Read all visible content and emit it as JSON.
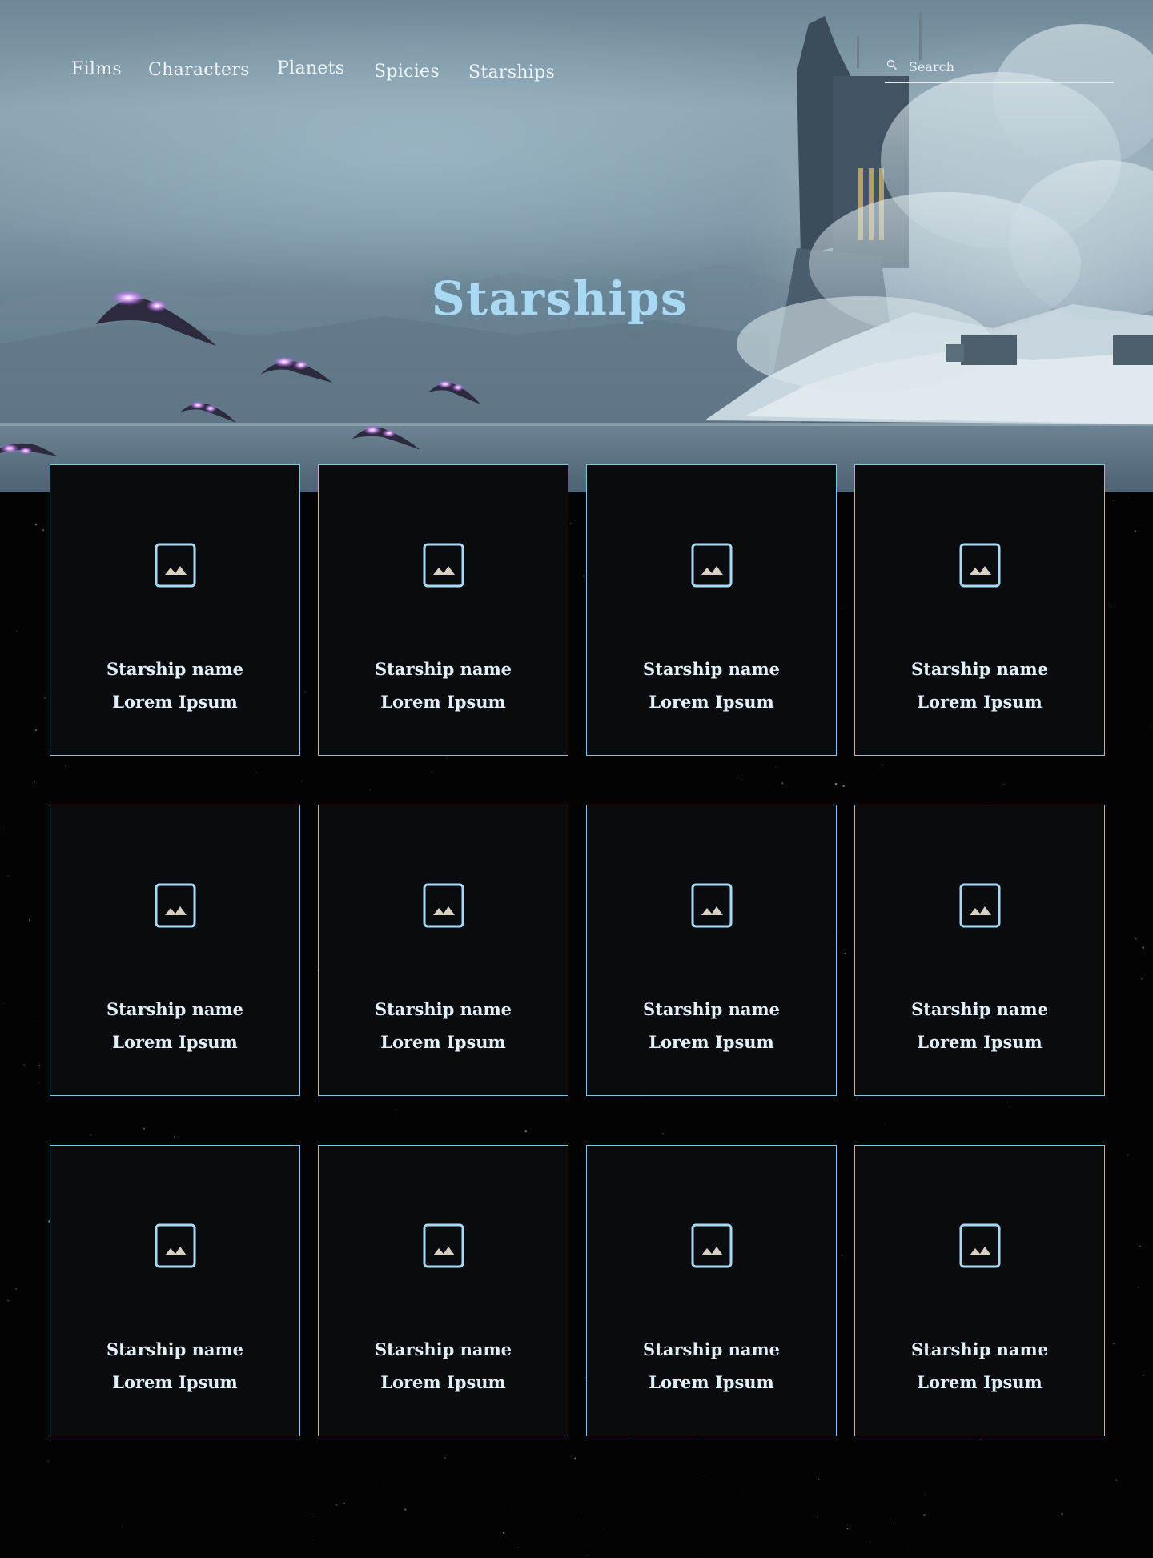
{
  "nav": {
    "items": [
      {
        "label": "Films"
      },
      {
        "label": "Characters"
      },
      {
        "label": "Planets"
      },
      {
        "label": "Spicies"
      },
      {
        "label": "Starships"
      }
    ]
  },
  "search": {
    "placeholder": "Search",
    "value": "",
    "icon": "search-icon"
  },
  "hero": {
    "title": "Starships"
  },
  "colors": {
    "accent": "#a9d9f3",
    "card_border": "#8fbfd9",
    "card_bg": "#0a0b0f",
    "page_bg": "#030304",
    "ship_glow": "#c77dff"
  },
  "cards": [
    {
      "name": "Starship name",
      "subtitle": "Lorem Ipsum",
      "icon": "image-placeholder-icon"
    },
    {
      "name": "Starship name",
      "subtitle": "Lorem Ipsum",
      "icon": "image-placeholder-icon"
    },
    {
      "name": "Starship name",
      "subtitle": "Lorem Ipsum",
      "icon": "image-placeholder-icon"
    },
    {
      "name": "Starship name",
      "subtitle": "Lorem Ipsum",
      "icon": "image-placeholder-icon"
    },
    {
      "name": "Starship name",
      "subtitle": "Lorem Ipsum",
      "icon": "image-placeholder-icon"
    },
    {
      "name": "Starship name",
      "subtitle": "Lorem Ipsum",
      "icon": "image-placeholder-icon"
    },
    {
      "name": "Starship name",
      "subtitle": "Lorem Ipsum",
      "icon": "image-placeholder-icon"
    },
    {
      "name": "Starship name",
      "subtitle": "Lorem Ipsum",
      "icon": "image-placeholder-icon"
    },
    {
      "name": "Starship name",
      "subtitle": "Lorem Ipsum",
      "icon": "image-placeholder-icon"
    },
    {
      "name": "Starship name",
      "subtitle": "Lorem Ipsum",
      "icon": "image-placeholder-icon"
    },
    {
      "name": "Starship name",
      "subtitle": "Lorem Ipsum",
      "icon": "image-placeholder-icon"
    },
    {
      "name": "Starship name",
      "subtitle": "Lorem Ipsum",
      "icon": "image-placeholder-icon"
    }
  ]
}
